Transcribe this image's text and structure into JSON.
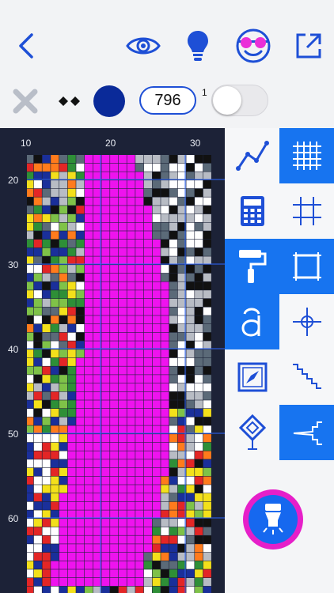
{
  "counter": {
    "value": "796",
    "superscript": "1"
  },
  "colors": {
    "selected_thread": "#0a2a99",
    "accent": "#1e4fd6",
    "tool_active": "#1774f0",
    "fab_ring": "#e61fc9"
  },
  "ruler": {
    "top": [
      "10",
      "20",
      "30"
    ],
    "left": [
      "20",
      "30",
      "40",
      "50",
      "60"
    ]
  },
  "toolbar": {
    "icons": [
      "back-icon",
      "eye-icon",
      "lightbulb-icon",
      "glasses-face-icon",
      "expand-icon"
    ]
  },
  "tools": {
    "left_column": [
      "line-graph-icon",
      "calculator-icon",
      "paint-roller-icon",
      "font-icon",
      "compass-icon",
      "diamond-icon"
    ],
    "right_column": [
      "fine-grid-icon",
      "coarse-grid-icon",
      "crop-frame-icon",
      "crosshair-icon",
      "staircase-icon",
      "zigzag-icon"
    ],
    "active": [
      "fine-grid-icon",
      "paint-roller-icon",
      "crop-frame-icon",
      "font-icon",
      "zigzag-icon"
    ]
  },
  "fab": {
    "icon": "flashlight-icon"
  }
}
